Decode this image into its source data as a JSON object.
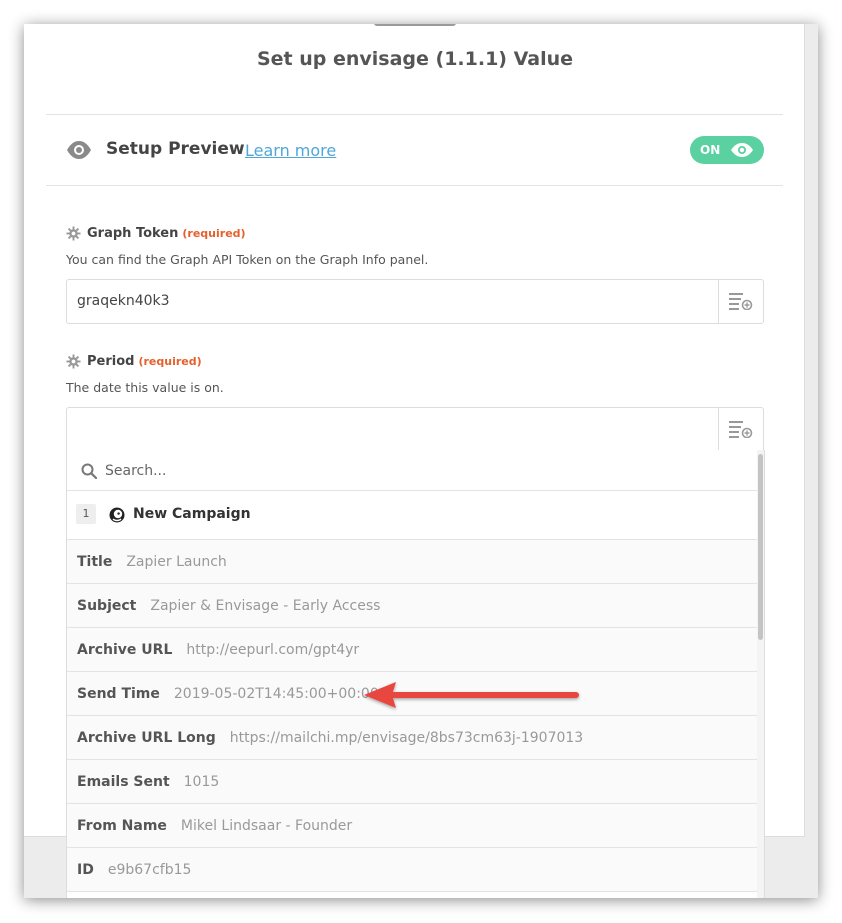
{
  "header": {
    "title": "Set up envisage (1.1.1) Value"
  },
  "preview": {
    "label": "Setup Preview",
    "learn_more": "Learn more",
    "toggle_label": "ON",
    "toggle_color": "#5bd1a1"
  },
  "fields": {
    "graph_token": {
      "label": "Graph Token",
      "required": "(required)",
      "help": "You can find the Graph API Token on the Graph Info panel.",
      "value": "graqekn40k3"
    },
    "period": {
      "label": "Period",
      "required": "(required)",
      "help": "The date this value is on.",
      "value": ""
    }
  },
  "dropdown": {
    "search_placeholder": "Search...",
    "step": {
      "number": "1",
      "app_icon": "mailchimp-icon",
      "name": "New Campaign"
    },
    "rows": [
      {
        "key": "Title",
        "value": "Zapier Launch"
      },
      {
        "key": "Subject",
        "value": "Zapier & Envisage - Early Access"
      },
      {
        "key": "Archive URL",
        "value": "http://eepurl.com/gpt4yr"
      },
      {
        "key": "Send Time",
        "value": "2019-05-02T14:45:00+00:00"
      },
      {
        "key": "Archive URL Long",
        "value": "https://mailchi.mp/envisage/8bs73cm63j-1907013"
      },
      {
        "key": "Emails Sent",
        "value": "1015"
      },
      {
        "key": "From Name",
        "value": "Mikel Lindsaar - Founder"
      },
      {
        "key": "ID",
        "value": "e9b67cfb15"
      }
    ]
  },
  "colors": {
    "accent_link": "#4ea7d8",
    "required": "#e5602c",
    "annotation_arrow": "#e8473f"
  }
}
